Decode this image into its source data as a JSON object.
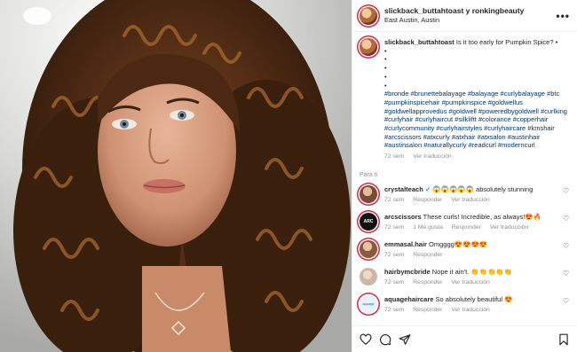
{
  "header": {
    "username": "slickback_buttahtoast y ronkingbeauty",
    "location": "East Austin, Austin",
    "more_label": "•••"
  },
  "caption": {
    "username": "slickback_buttahtoast",
    "text": "Is it too early for Pumpkin Spice? •",
    "bullets": [
      "•",
      "•",
      "•",
      "•",
      "•"
    ],
    "hashtags": "#bronde #brunettebalayage #balayage #curlybalayage #btc #pumpkinspicehair #pumpkinspice #goldwellus #goldwellapprovedus #goldwell #poweredbygoldwell #curlking #curlyhair #curlyhaircut #silkliftt #colorance #copperhair #curlycommunity #curlyhairstyles #curlyhaircare #kmshair #arcscissors #atxcurly #atxhair #atxsalon #austinhair #austinsalon #naturallycurly #readcurl #moderncurl",
    "time": "72 sem",
    "translate": "Ver traducción"
  },
  "more_of": "Para ti",
  "comments": [
    {
      "user": "crystalteach",
      "verified": "✔",
      "text": "😱😱😱😱😱 absolutely stunning",
      "time": "72 sem",
      "likes": "",
      "reply": "Responder",
      "translate": "Ver traducción",
      "avatar_color": "#7a4b3a"
    },
    {
      "user": "arcscissors",
      "verified": "",
      "text": "These curls! Incredible, as always!😍🔥",
      "time": "72 sem",
      "likes": "1 Me gusta",
      "reply": "Responder",
      "translate": "Ver traducción",
      "avatar_color": "#1a1a1a"
    },
    {
      "user": "emmasal.hair",
      "verified": "",
      "text": "Omgggg😍😍😍😍",
      "time": "72 sem",
      "likes": "",
      "reply": "Responder",
      "translate": "",
      "avatar_color": "#8a5a3c"
    },
    {
      "user": "hairbymcbride",
      "verified": "",
      "text": "Nope it ain't. 👏👏👏👏👏",
      "time": "72 sem",
      "likes": "",
      "reply": "Responder",
      "translate": "Ver traducción",
      "avatar_color": "#c9b8a8"
    },
    {
      "user": "aquagehaircare",
      "verified": "",
      "text": "So absolutely beautiful 😍",
      "time": "72 sem",
      "likes": "",
      "reply": "Responder",
      "translate": "Ver traducción",
      "avatar_color": "#cfe3ef"
    }
  ],
  "footer": {
    "icons": [
      "heart-icon",
      "comment-icon",
      "share-icon",
      "bookmark-icon"
    ]
  },
  "colors": {
    "link": "#00376b",
    "muted": "#8e8e8e",
    "text": "#262626"
  }
}
